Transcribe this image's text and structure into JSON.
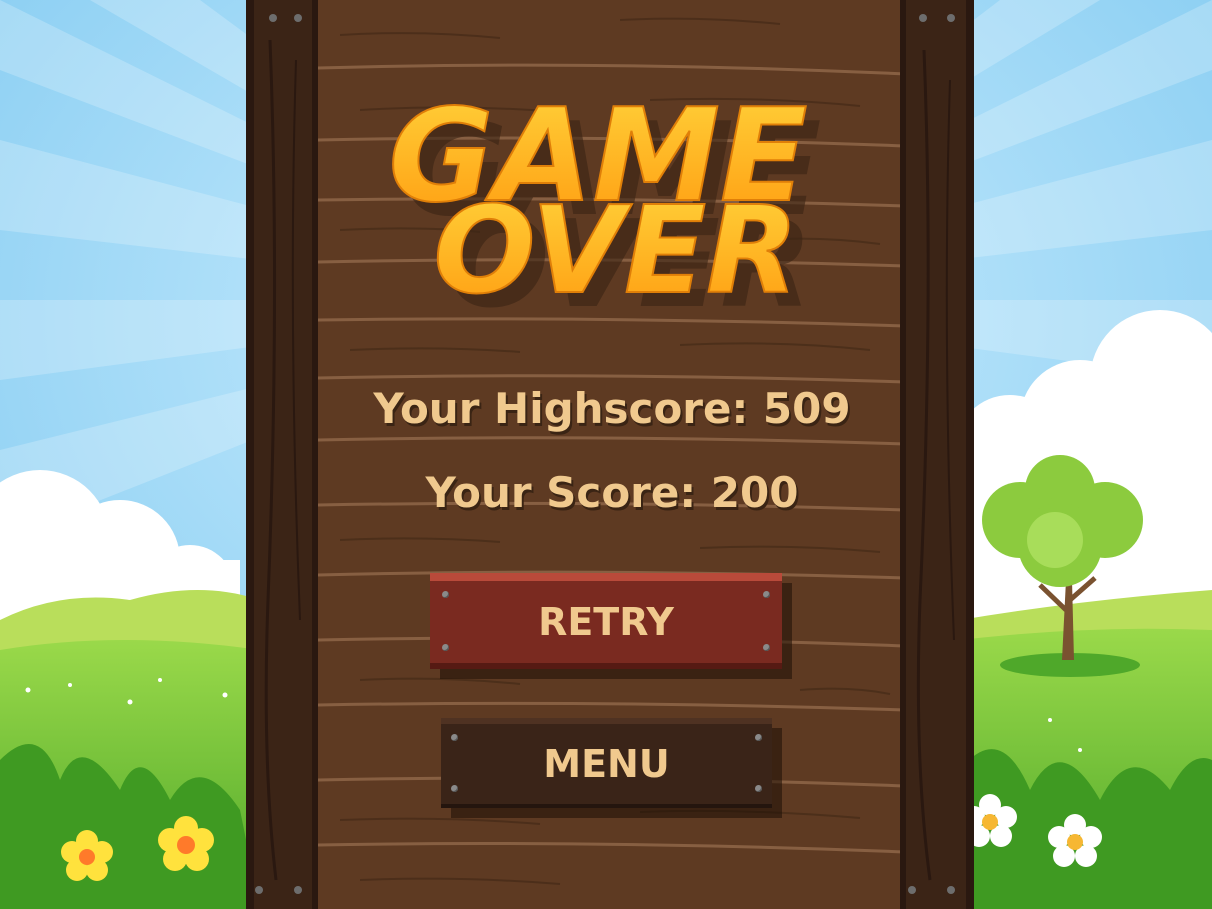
{
  "screen": "game-over",
  "title": {
    "line1": "GAME",
    "line2": "OVER"
  },
  "stats": {
    "highscore_text": "Your Highscore: 509",
    "score_text": "Your Score: 200"
  },
  "buttons": {
    "retry_label": "RETRY",
    "menu_label": "MENU"
  },
  "colors": {
    "sky": "#8FD0F2",
    "wood": "#5E3A22",
    "post": "#3B2416",
    "title_fill": "#FFB21C",
    "text_cream": "#F0C98E",
    "retry_button": "#7A2A20",
    "menu_button": "#3A2418",
    "grass": "#6CC13A"
  }
}
